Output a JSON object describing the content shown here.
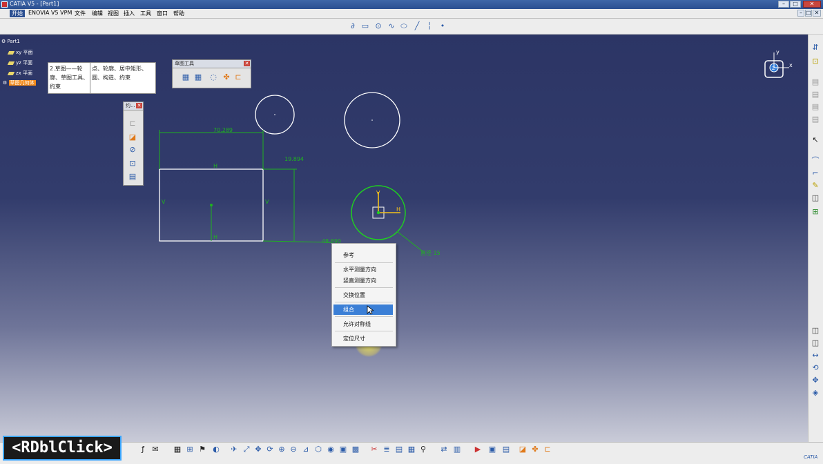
{
  "window": {
    "title": "CATIA V5 - [Part1]"
  },
  "menubar": {
    "items": [
      "开始",
      "ENOVIA V5 VPM",
      "文件",
      "编辑",
      "视图",
      "插入",
      "工具",
      "窗口",
      "帮助"
    ]
  },
  "tree": {
    "root": "Part1",
    "items": [
      "xy 平面",
      "yz 平面",
      "zx 平面",
      "草图几何体"
    ]
  },
  "note": {
    "col1": "2.草图——轮廓、草图工具、约束",
    "col2": "点、轮廓、居中矩形、圆、构造、约束"
  },
  "sketch_tools": {
    "title": "草图工具"
  },
  "constraint_toolbar": {
    "title": "约..."
  },
  "dimensions": {
    "width": "70.289",
    "height": "19.894",
    "offset": "48.890",
    "diameter": "直径 15"
  },
  "constraint_labels": {
    "top": "H",
    "left": "V",
    "right": "V",
    "center": "",
    "bottom": "H"
  },
  "axis_labels": {
    "h": "H",
    "v": "V"
  },
  "compass": {
    "x": "x",
    "y": "y",
    "z": "z"
  },
  "context_menu": {
    "items": [
      "参考",
      "水平测量方向",
      "竖直测量方向",
      "交换位置",
      "组合",
      "允许对称线",
      "定位尺寸"
    ],
    "selected_index": 4
  },
  "overlay": {
    "text": "<RDblClick>"
  },
  "brand": {
    "text": "CATIA"
  }
}
